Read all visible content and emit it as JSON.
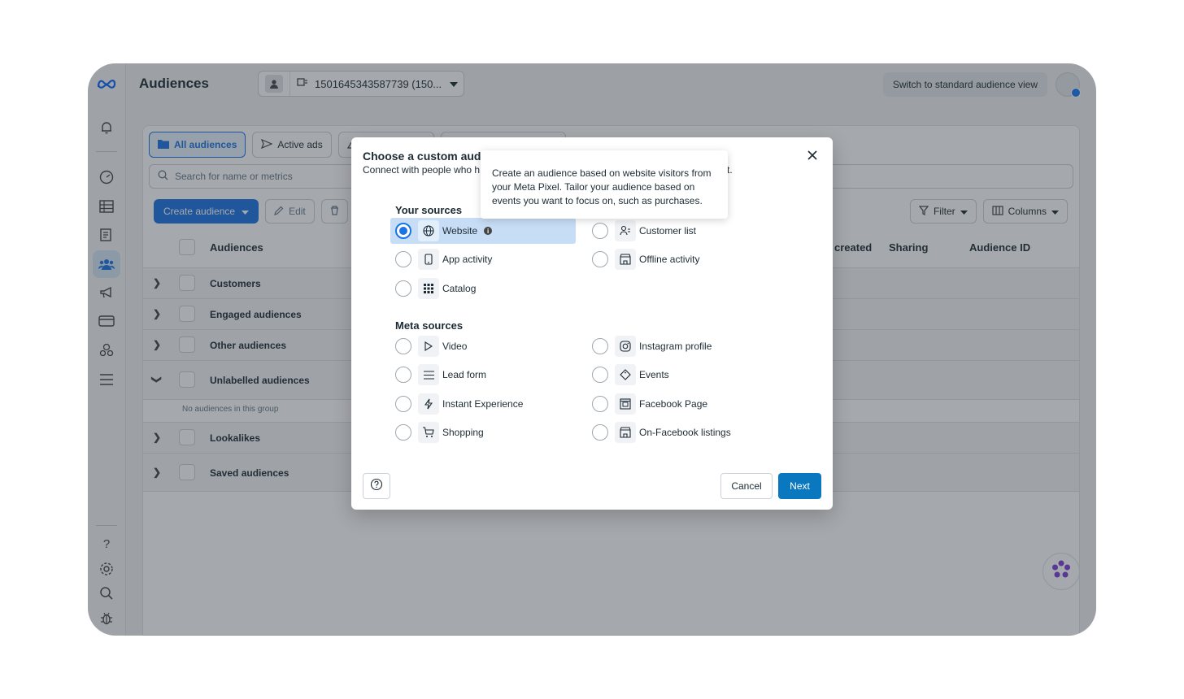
{
  "header": {
    "title": "Audiences",
    "account_label": "1501645343587739 (150...",
    "switch_button": "Switch to standard audience view"
  },
  "tabs": [
    {
      "label": "All audiences"
    },
    {
      "label": "Active ads"
    }
  ],
  "search": {
    "placeholder": "Search for name or metrics"
  },
  "toolbar": {
    "create_label": "Create audience",
    "edit_label": "Edit",
    "filter_label": "Filter",
    "columns_label": "Columns"
  },
  "table": {
    "headers": {
      "audiences": "Audiences",
      "created": "created",
      "sharing": "Sharing",
      "audience_id": "Audience ID"
    },
    "rows": [
      {
        "label": "Customers"
      },
      {
        "label": "Engaged audiences"
      },
      {
        "label": "Other audiences"
      },
      {
        "label": "Unlabelled audiences"
      },
      {
        "label": "Lookalikes"
      },
      {
        "label": "Saved audiences"
      }
    ],
    "empty_note": "No audiences in this group"
  },
  "modal": {
    "title": "Choose a custom audie",
    "subtitle": "Connect with people who h",
    "subtitle_end": "t.",
    "your_sources_label": "Your sources",
    "your_sources": [
      {
        "label": "Website",
        "icon": "globe-icon",
        "selected": true
      },
      {
        "label": "Customer list",
        "icon": "person-list-icon"
      },
      {
        "label": "App activity",
        "icon": "phone-icon"
      },
      {
        "label": "Offline activity",
        "icon": "store-icon"
      },
      {
        "label": "Catalog",
        "icon": "grid-icon"
      }
    ],
    "meta_sources_label": "Meta sources",
    "meta_sources": [
      {
        "label": "Video",
        "icon": "play-icon"
      },
      {
        "label": "Instagram profile",
        "icon": "instagram-icon"
      },
      {
        "label": "Lead form",
        "icon": "lines-icon"
      },
      {
        "label": "Events",
        "icon": "ticket-icon"
      },
      {
        "label": "Instant Experience",
        "icon": "bolt-icon"
      },
      {
        "label": "Facebook Page",
        "icon": "page-icon"
      },
      {
        "label": "Shopping",
        "icon": "cart-icon"
      },
      {
        "label": "On-Facebook listings",
        "icon": "store-icon"
      }
    ],
    "cancel_label": "Cancel",
    "next_label": "Next"
  },
  "tooltip": {
    "text": "Create an audience based on website visitors from your Meta Pixel. Tailor your audience based on events you want to focus on, such as purchases."
  },
  "colors": {
    "accent": "#1b74e4",
    "next_button": "#0a78be",
    "selected_option": "#c7ddf5"
  }
}
